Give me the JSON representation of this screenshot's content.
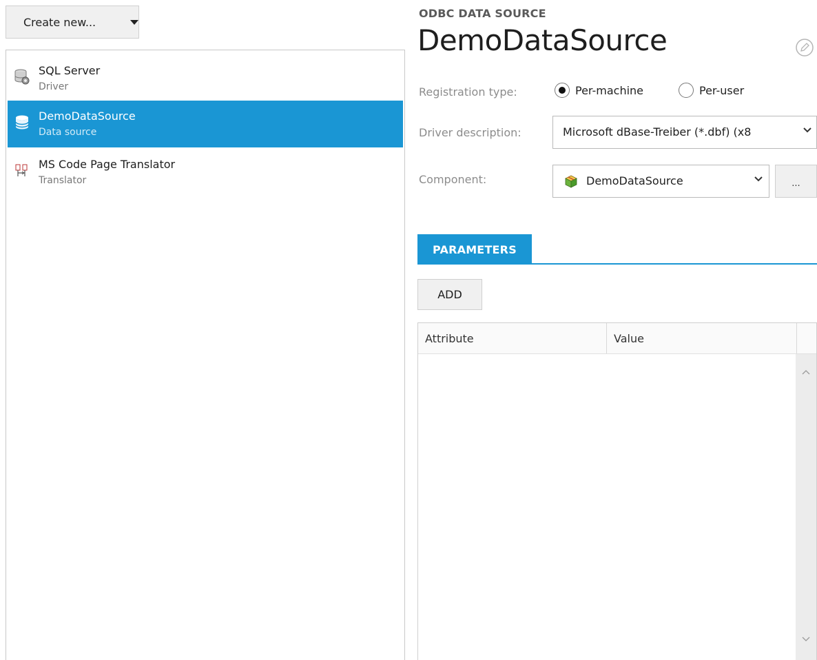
{
  "toolbar": {
    "create_label": "Create new..."
  },
  "list": {
    "items": [
      {
        "title": "SQL Server",
        "subtitle": "Driver",
        "icon": "sql-server-driver-icon"
      },
      {
        "title": "DemoDataSource",
        "subtitle": "Data source",
        "icon": "database-icon",
        "selected": true
      },
      {
        "title": "MS Code Page Translator",
        "subtitle": "Translator",
        "icon": "translator-icon"
      }
    ]
  },
  "detail": {
    "section_label": "ODBC DATA SOURCE",
    "title": "DemoDataSource",
    "registration": {
      "label": "Registration type:",
      "options": [
        "Per-machine",
        "Per-user"
      ],
      "selected": "Per-machine"
    },
    "driver": {
      "label": "Driver description:",
      "value": "Microsoft dBase-Treiber (*.dbf) (x8"
    },
    "component": {
      "label": "Component:",
      "value": "DemoDataSource",
      "browse_label": "..."
    }
  },
  "parameters": {
    "tab_label": "PARAMETERS",
    "add_label": "ADD",
    "columns": [
      "Attribute",
      "Value"
    ],
    "rows": []
  },
  "colors": {
    "accent": "#1a96d4"
  }
}
